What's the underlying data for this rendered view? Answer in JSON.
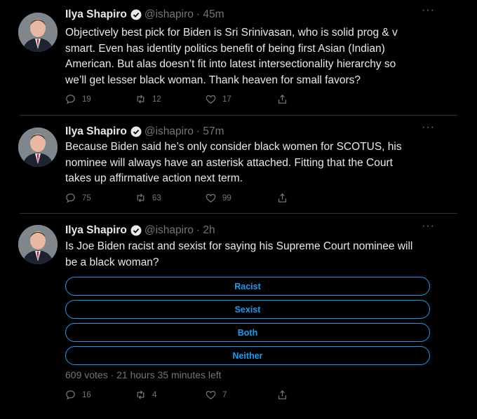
{
  "tweets": [
    {
      "name": "Ilya Shapiro",
      "handle": "@ishapiro",
      "time": "· 45m",
      "more": "···",
      "lines": [
        "Objectively best pick for Biden is Sri Srinivasan, who is solid prog & v",
        "smart. Even has identity politics benefit of being first Asian (Indian)",
        "American. But alas doesn’t fit into latest intersectionality hierarchy so",
        "we’ll get lesser black woman. Thank heaven for small favors?"
      ],
      "replies": "19",
      "retweets": "12",
      "likes": "17"
    },
    {
      "name": "Ilya Shapiro",
      "handle": "@ishapiro",
      "time": "· 57m",
      "more": "···",
      "lines": [
        "Because Biden said he’s only consider black women for SCOTUS, his",
        "nominee will always have an asterisk attached. Fitting that the Court",
        "takes up affirmative action next term."
      ],
      "replies": "75",
      "retweets": "63",
      "likes": "99"
    },
    {
      "name": "Ilya Shapiro",
      "handle": "@ishapiro",
      "time": "· 2h",
      "more": "···",
      "lines": [
        "Is Joe Biden racist and sexist for saying  his Supreme Court nominee will",
        "be a black woman?"
      ],
      "poll": {
        "options": [
          "Racist",
          "Sexist",
          "Both",
          "Neither"
        ],
        "meta": "609 votes · 21 hours 35 minutes left"
      },
      "replies": "16",
      "retweets": "4",
      "likes": "7"
    }
  ],
  "icons": {
    "verified": "verified-badge-icon",
    "reply": "reply-icon",
    "retweet": "retweet-icon",
    "like": "heart-icon",
    "share": "share-icon"
  },
  "colors": {
    "background": "#000000",
    "text": "#e7e9ea",
    "muted": "#71767b",
    "accent": "#1d9bf0"
  }
}
